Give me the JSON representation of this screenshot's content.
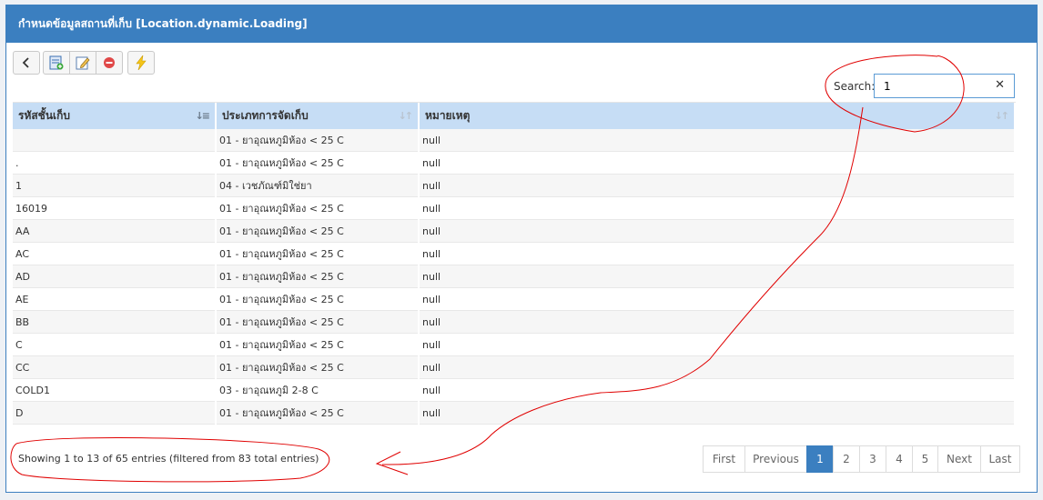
{
  "panel": {
    "title": "กำหนดข้อมูลสถานที่เก็บ [Location.dynamic.Loading]"
  },
  "toolbar": {
    "back_icon": "chevron-left-icon",
    "add_icon": "add-record-icon",
    "edit_icon": "edit-record-icon",
    "delete_icon": "delete-icon",
    "bolt_icon": "lightning-icon"
  },
  "search": {
    "label": "Search:",
    "value": "1",
    "clear": "✕"
  },
  "table": {
    "columns": [
      "รหัสชั้นเก็บ",
      "ประเภทการจัดเก็บ",
      "หมายเหตุ"
    ],
    "rows": [
      [
        "",
        "01 - ยาอุณหภูมิห้อง < 25 C",
        "null"
      ],
      [
        ".",
        "01 - ยาอุณหภูมิห้อง < 25 C",
        "null"
      ],
      [
        "1",
        "04 - เวชภัณฑ์มิใช่ยา",
        "null"
      ],
      [
        "16019",
        "01 - ยาอุณหภูมิห้อง < 25 C",
        "null"
      ],
      [
        "AA",
        "01 - ยาอุณหภูมิห้อง < 25 C",
        "null"
      ],
      [
        "AC",
        "01 - ยาอุณหภูมิห้อง < 25 C",
        "null"
      ],
      [
        "AD",
        "01 - ยาอุณหภูมิห้อง < 25 C",
        "null"
      ],
      [
        "AE",
        "01 - ยาอุณหภูมิห้อง < 25 C",
        "null"
      ],
      [
        "BB",
        "01 - ยาอุณหภูมิห้อง < 25 C",
        "null"
      ],
      [
        "C",
        "01 - ยาอุณหภูมิห้อง < 25 C",
        "null"
      ],
      [
        "CC",
        "01 - ยาอุณหภูมิห้อง < 25 C",
        "null"
      ],
      [
        "COLD1",
        "03 - ยาอุณหภูมิ 2-8 C",
        "null"
      ],
      [
        "D",
        "01 - ยาอุณหภูมิห้อง < 25 C",
        "null"
      ]
    ]
  },
  "info": "Showing 1 to 13 of 65 entries (filtered from 83 total entries)",
  "pagination": {
    "first": "First",
    "previous": "Previous",
    "pages": [
      "1",
      "2",
      "3",
      "4",
      "5"
    ],
    "next": "Next",
    "last": "Last",
    "current": "1"
  },
  "colors": {
    "header": "#3b7fc0",
    "th_bg": "#c6ddf5",
    "annotation": "#e00000"
  }
}
